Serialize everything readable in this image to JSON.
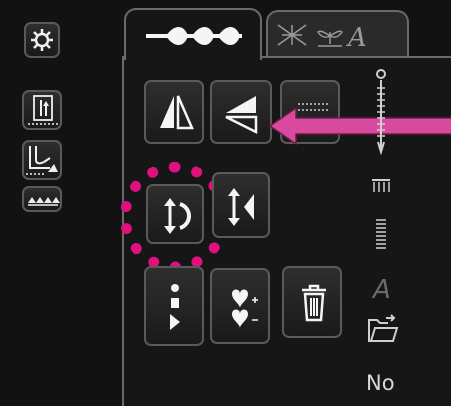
{
  "colors": {
    "background": "#121212",
    "button_border": "#5a5a5a",
    "icon": "#f2f2f2",
    "highlight_circle": "#e0107f",
    "arrow": "#d94a9f"
  },
  "tabs": [
    {
      "icon": "stitch-sequence-icon",
      "active": true
    },
    {
      "icon": "embroidery-font-icon",
      "active": false
    }
  ],
  "sidebar_icons": [
    "settings-gear-icon",
    "stitch-length-icon",
    "presser-foot-icon",
    "feed-dogs-icon"
  ],
  "buttons": [
    "mirror-side-to-side-button",
    "mirror-end-to-end-button",
    "stitch-density-button",
    "reverse-direction-button",
    "mirror-flip-button",
    "single-pattern-button",
    "pattern-repeat-button",
    "delete-button"
  ],
  "right_strip_icons": [
    "needle-thread-icon",
    "tension-icon",
    "stitch-width-icon",
    "letter-icon",
    "folder-icon"
  ],
  "status": {
    "no_label": "No"
  }
}
